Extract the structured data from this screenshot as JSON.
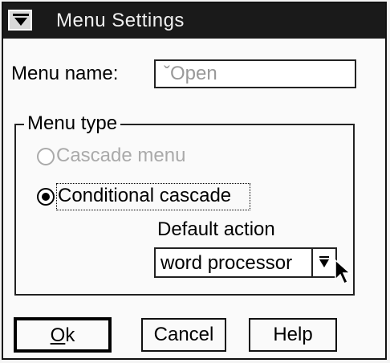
{
  "window": {
    "title": "Menu Settings"
  },
  "menu_name": {
    "label": "Menu name:",
    "value": "ˇOpen"
  },
  "menu_type": {
    "group_label": "Menu type",
    "options": [
      {
        "label": "Cascade menu",
        "selected": false,
        "enabled": false
      },
      {
        "label": "Conditional cascade",
        "selected": true,
        "enabled": true
      }
    ]
  },
  "default_action": {
    "label": "Default action",
    "value": "word processor"
  },
  "buttons": {
    "ok_mnemonic": "O",
    "ok_rest": "k",
    "cancel": "Cancel",
    "help": "Help"
  },
  "icons": {
    "system_menu": "system-menu-icon",
    "dropdown": "dropdown-arrow-icon",
    "cursor": "mouse-pointer-icon"
  }
}
